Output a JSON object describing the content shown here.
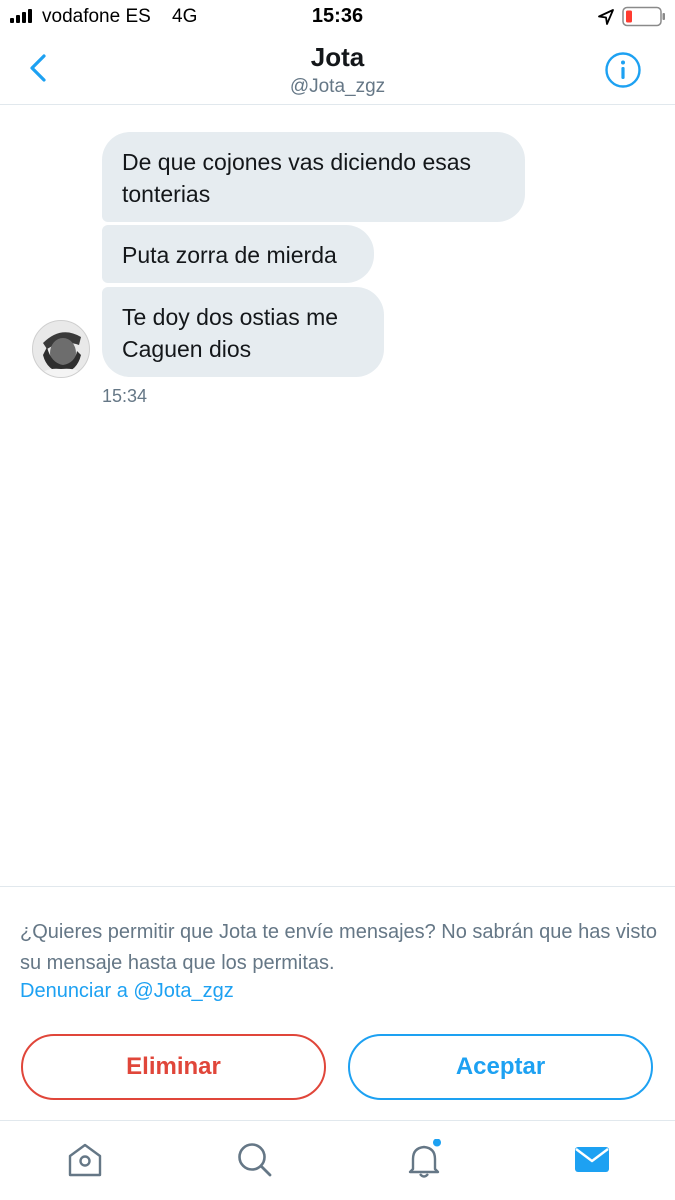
{
  "status_bar": {
    "carrier": "vodafone ES",
    "network": "4G",
    "time": "15:36"
  },
  "header": {
    "name": "Jota",
    "handle": "@Jota_zgz"
  },
  "messages": [
    {
      "text": "De que cojones vas diciendo esas tonterias"
    },
    {
      "text": "Puta zorra de mierda"
    },
    {
      "text": "Te doy dos ostias me Caguen dios"
    }
  ],
  "message_time": "15:34",
  "request": {
    "prompt": "¿Quieres permitir que Jota te envíe mensajes? No sabrán que has visto su mensaje hasta que los permitas.",
    "report_link": "Denunciar a @Jota_zgz",
    "delete_label": "Eliminar",
    "accept_label": "Aceptar"
  },
  "colors": {
    "accent": "#1da1f2",
    "danger": "#e0463a",
    "bubble": "#e6ecf0"
  },
  "icons": {
    "tabs": [
      "home-icon",
      "search-icon",
      "notifications-icon",
      "messages-icon"
    ]
  }
}
